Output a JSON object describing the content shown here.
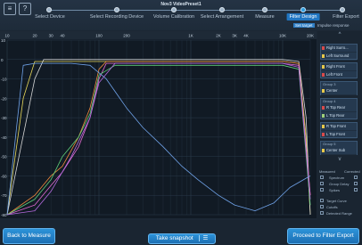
{
  "app": {
    "title": "Nov3 VideoPreset1",
    "icon_left": "menu-icon",
    "icon_help": "?"
  },
  "steps": [
    {
      "label": "Select Device",
      "active": false
    },
    {
      "label": "Select Recording Device",
      "active": false
    },
    {
      "label": "Volume Calibration",
      "active": false
    },
    {
      "label": "Select Arrangement",
      "active": false
    },
    {
      "label": "Measure",
      "active": false
    },
    {
      "label": "Filter Design",
      "active": true
    },
    {
      "label": "Filter Export",
      "active": false
    }
  ],
  "subtabs": {
    "set_target": "Set target",
    "impulse_response": "Impulse response"
  },
  "chart_data": {
    "type": "line",
    "x_scale": "log",
    "xlim": [
      10,
      20000
    ],
    "ylim": [
      -80,
      10
    ],
    "x_ticks": [
      "10",
      "20",
      "30",
      "40",
      "100",
      "200",
      "1K",
      "2K",
      "3K",
      "4K",
      "10K",
      "20K"
    ],
    "x_tick_values": [
      10,
      20,
      30,
      40,
      100,
      200,
      1000,
      2000,
      3000,
      4000,
      10000,
      20000
    ],
    "y_ticks": [
      "10",
      "0",
      "-10",
      "-20",
      "-30",
      "-40",
      "-50",
      "-60",
      "-70",
      "-80"
    ],
    "y_tick_values": [
      10,
      0,
      -10,
      -20,
      -30,
      -40,
      -50,
      -60,
      -70,
      -80
    ],
    "grid": true,
    "series": [
      {
        "color": "#e8d85a",
        "x": [
          10,
          15,
          20,
          25,
          30,
          40,
          60,
          100,
          200,
          500,
          1000,
          2000,
          5000,
          10000,
          15000,
          18000,
          20000
        ],
        "y": [
          -80,
          -20,
          -1,
          -1,
          -1,
          -1,
          -1,
          -1,
          -1,
          -1,
          -1,
          -1,
          -1,
          -1,
          -2,
          -40,
          -80
        ]
      },
      {
        "color": "#d6d6d6",
        "x": [
          10,
          20,
          25,
          30,
          40,
          60,
          100,
          200,
          500,
          1000,
          2000,
          5000,
          10000,
          15000,
          18000,
          20000
        ],
        "y": [
          -80,
          -10,
          0,
          0,
          0,
          0,
          0,
          0,
          0,
          0,
          0,
          0,
          0,
          -1,
          -30,
          -80
        ]
      },
      {
        "color": "#f08a3c",
        "x": [
          10,
          20,
          30,
          40,
          60,
          80,
          100,
          120,
          150,
          200,
          500,
          1000,
          5000,
          10000,
          15000,
          20000
        ],
        "y": [
          -80,
          -70,
          -60,
          -55,
          -40,
          -25,
          -5,
          -1,
          -1,
          -1,
          -1,
          -1,
          -1,
          -1,
          -2,
          -70
        ]
      },
      {
        "color": "#e06ad0",
        "x": [
          10,
          20,
          30,
          40,
          60,
          80,
          100,
          120,
          150,
          200,
          500,
          1000,
          5000,
          10000,
          15000,
          20000
        ],
        "y": [
          -80,
          -75,
          -65,
          -58,
          -45,
          -30,
          -10,
          -2,
          -2,
          -2,
          -2,
          -2,
          -2,
          -2,
          -3,
          -70
        ]
      },
      {
        "color": "#5fd07a",
        "x": [
          10,
          20,
          30,
          40,
          60,
          80,
          100,
          150,
          200,
          500,
          1000,
          5000,
          10000,
          15000,
          20000
        ],
        "y": [
          -80,
          -72,
          -62,
          -50,
          -40,
          -28,
          -8,
          -3,
          -3,
          -3,
          -3,
          -3,
          -3,
          -5,
          -75
        ]
      },
      {
        "color": "#6fa2e8",
        "x": [
          10,
          15,
          20,
          30,
          50,
          80,
          120,
          200,
          300,
          500,
          800,
          1200,
          2000,
          3000,
          5000,
          8000,
          12000,
          20000
        ],
        "y": [
          -80,
          -3,
          -2,
          -2,
          -2,
          -3,
          -10,
          -25,
          -35,
          -45,
          -55,
          -62,
          -70,
          -75,
          -78,
          -74,
          -66,
          -60
        ]
      },
      {
        "color": "#b56adf",
        "x": [
          10,
          20,
          30,
          50,
          80,
          100,
          150,
          200,
          500,
          1000,
          5000,
          10000,
          15000,
          20000
        ],
        "y": [
          -80,
          -78,
          -68,
          -50,
          -30,
          -12,
          -2,
          -2,
          -2,
          -2,
          -2,
          -2,
          -4,
          -72
        ]
      }
    ]
  },
  "sidebar": {
    "chevron": "^",
    "groups": [
      {
        "head": "",
        "items": [
          {
            "label": "Right Surro...",
            "color": "#d94a4a"
          },
          {
            "label": "Left Surround",
            "color": "#e6c84a"
          }
        ]
      },
      {
        "head": "",
        "items": [
          {
            "label": "Right Front",
            "color": "#e6c84a"
          },
          {
            "label": "Left Front",
            "color": "#d94a4a"
          }
        ]
      },
      {
        "head": "Group 3",
        "items": [
          {
            "label": "Center",
            "color": "#e6c84a"
          }
        ]
      },
      {
        "head": "Group 4",
        "items": [
          {
            "label": "R Top Rear",
            "color": "#d94a4a"
          },
          {
            "label": "L Top Rear",
            "color": "#9fd07a"
          }
        ]
      },
      {
        "head": "",
        "items": [
          {
            "label": "R Top Front",
            "color": "#e6c84a"
          },
          {
            "label": "L Top Front",
            "color": "#d94a4a"
          }
        ]
      },
      {
        "head": "Group 5",
        "items": [
          {
            "label": "Center Sub",
            "color": "#e6c84a"
          }
        ]
      }
    ],
    "columns": {
      "measured": "Measured",
      "corrected": "Corrected"
    },
    "options": [
      "Spectrum",
      "Group Delay",
      "Spikes"
    ],
    "extra_options": [
      "Target Curve",
      "Cutoffs",
      "Detected Range"
    ]
  },
  "bottom": {
    "back": "Back to Measure",
    "snapshot": "Take snapshot",
    "proceed": "Proceed to Filter Export"
  }
}
